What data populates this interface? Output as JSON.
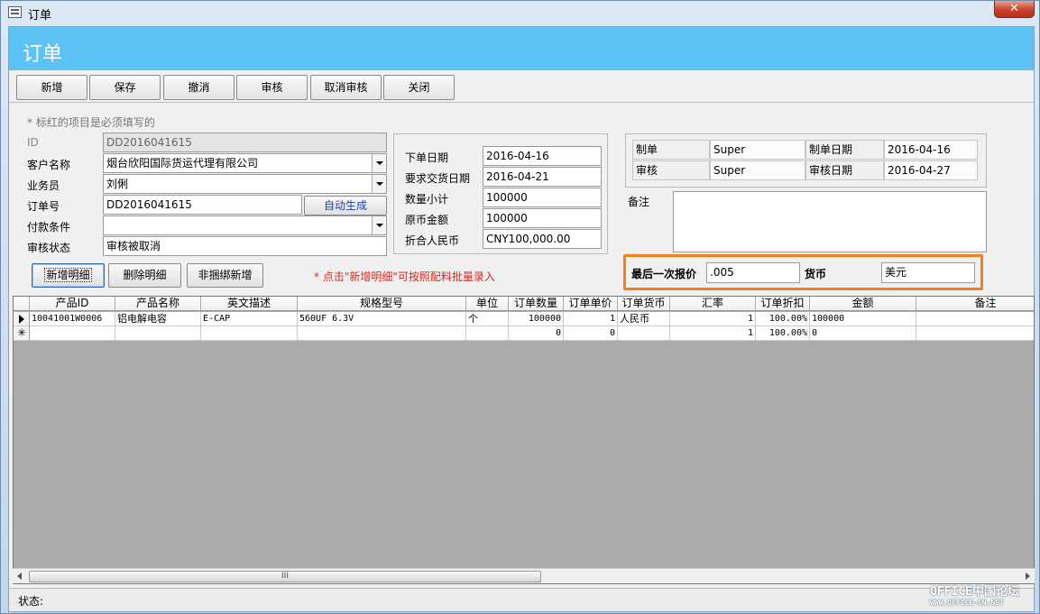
{
  "window": {
    "title": "订单",
    "close_label": "✕"
  },
  "header": {
    "title": "订单"
  },
  "toolbar": {
    "buttons": [
      "新增",
      "保存",
      "撤消",
      "审核",
      "取消审核",
      "关闭"
    ]
  },
  "form": {
    "hint": "* 标红的项目是必须填写的",
    "id_label": "ID",
    "id_value": "DD2016041615",
    "customer_label": "客户名称",
    "customer_value": "烟台欣阳国际货运代理有限公司",
    "salesman_label": "业务员",
    "salesman_value": "刘俐",
    "order_no_label": "订单号",
    "order_no_value": "DD2016041615",
    "auto_generate": "自动生成",
    "payment_label": "付款条件",
    "payment_value": "",
    "audit_status_label": "审核状态",
    "audit_status_value": "审核被取消"
  },
  "dates": {
    "order_date_label": "下单日期",
    "order_date_value": "2016-04-16",
    "delivery_date_label": "要求交货日期",
    "delivery_date_value": "2016-04-21",
    "qty_total_label": "数量小计",
    "qty_total_value": "100000",
    "orig_amount_label": "原币金额",
    "orig_amount_value": "100000",
    "rmb_label": "折合人民币",
    "rmb_value": "CNY100,000.00"
  },
  "audit_info": {
    "maker_label": "制单",
    "maker_value": "Super",
    "make_date_label": "制单日期",
    "make_date_value": "2016-04-16",
    "auditor_label": "审核",
    "auditor_value": "Super",
    "audit_date_label": "审核日期",
    "audit_date_value": "2016-04-27"
  },
  "remark": {
    "label": "备注",
    "value": ""
  },
  "detail_buttons": [
    "新增明细",
    "删除明细",
    "非捆绑新增"
  ],
  "red_hint": "* 点击\"新增明细\"可按照配料批量录入",
  "quote": {
    "last_price_label": "最后一次报价",
    "last_price_value": ".005",
    "currency_label": "货币",
    "currency_value": "美元"
  },
  "table": {
    "headers": [
      "产品ID",
      "产品名称",
      "英文描述",
      "规格型号",
      "单位",
      "订单数量",
      "订单单价",
      "订单货币",
      "汇率",
      "订单折扣",
      "金额",
      "备注"
    ],
    "rows": [
      [
        "10041001W0006",
        "铝电解电容",
        "E-CAP",
        "560UF 6.3V",
        "个",
        "100000",
        "1",
        "人民币",
        "1",
        "100.00%",
        "100000",
        ""
      ],
      [
        "",
        "",
        "",
        "",
        "",
        "0",
        "0",
        "",
        "1",
        "100.00%",
        "0",
        ""
      ]
    ],
    "scroll_grip": "III"
  },
  "status": {
    "label": "状态:"
  },
  "watermark": {
    "line1": "OFFICE中国论坛",
    "line2": "WWW.OFFICE-CN.NET"
  },
  "colors": {
    "header_band": "#5bc3f5",
    "highlight_border": "#f07f1c",
    "hint_red": "#e0241b"
  }
}
